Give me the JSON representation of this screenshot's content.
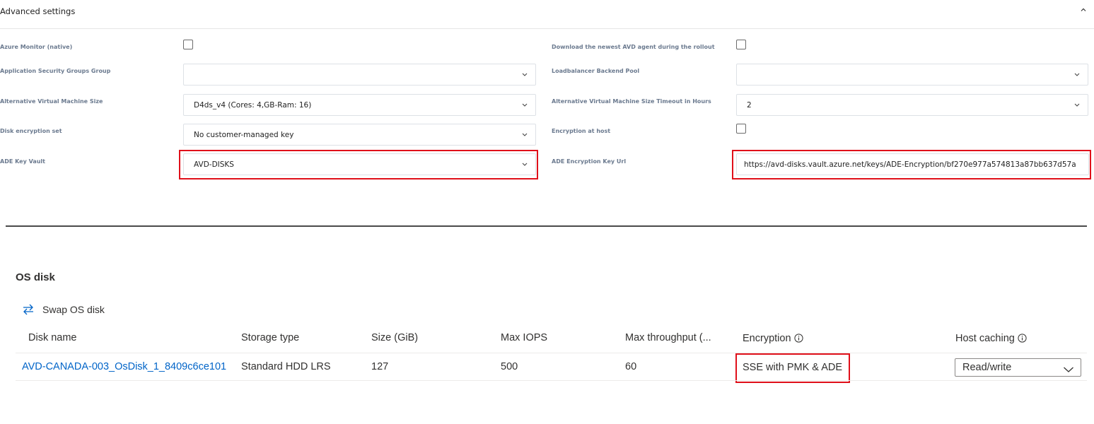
{
  "advanced": {
    "title": "Advanced settings",
    "collapse_icon": "chevron-up-icon",
    "labels": {
      "azure_monitor": "Azure Monitor (native)",
      "download_agent": "Download the newest AVD agent during the rollout",
      "asg_group": "Application Security Groups Group",
      "lb_pool": "Loadbalancer Backend Pool",
      "alt_vm_size": "Alternative Virtual Machine Size",
      "alt_vm_timeout": "Alternative Virtual Machine Size Timeout in Hours",
      "disk_enc_set": "Disk encryption set",
      "enc_at_host": "Encryption at host",
      "ade_key_vault": "ADE Key Vault",
      "ade_key_url": "ADE Encryption Key Url"
    },
    "values": {
      "azure_monitor_checked": false,
      "download_agent_checked": false,
      "asg_group": "",
      "lb_pool": "",
      "alt_vm_size": "D4ds_v4 (Cores: 4,GB-Ram: 16)",
      "alt_vm_timeout": "2",
      "disk_enc_set": "No customer-managed key",
      "enc_at_host_checked": false,
      "ade_key_vault": "AVD-DISKS",
      "ade_key_url": "https://avd-disks.vault.azure.net/keys/ADE-Encryption/bf270e977a574813a87bb637d57a"
    }
  },
  "os_disk": {
    "title": "OS disk",
    "swap_label": "Swap OS disk",
    "swap_icon": "swap-icon",
    "columns": [
      "Disk name",
      "Storage type",
      "Size (GiB)",
      "Max IOPS",
      "Max throughput (...",
      "Encryption",
      "Host caching"
    ],
    "row": {
      "disk_name": "AVD-CANADA-003_OsDisk_1_8409c6ce101",
      "storage_type": "Standard HDD LRS",
      "size": "127",
      "max_iops": "500",
      "max_throughput": "60",
      "encryption": "SSE with PMK & ADE",
      "host_caching": "Read/write"
    },
    "colors": {
      "link": "#0064c8",
      "highlight": "#e0101a"
    }
  }
}
